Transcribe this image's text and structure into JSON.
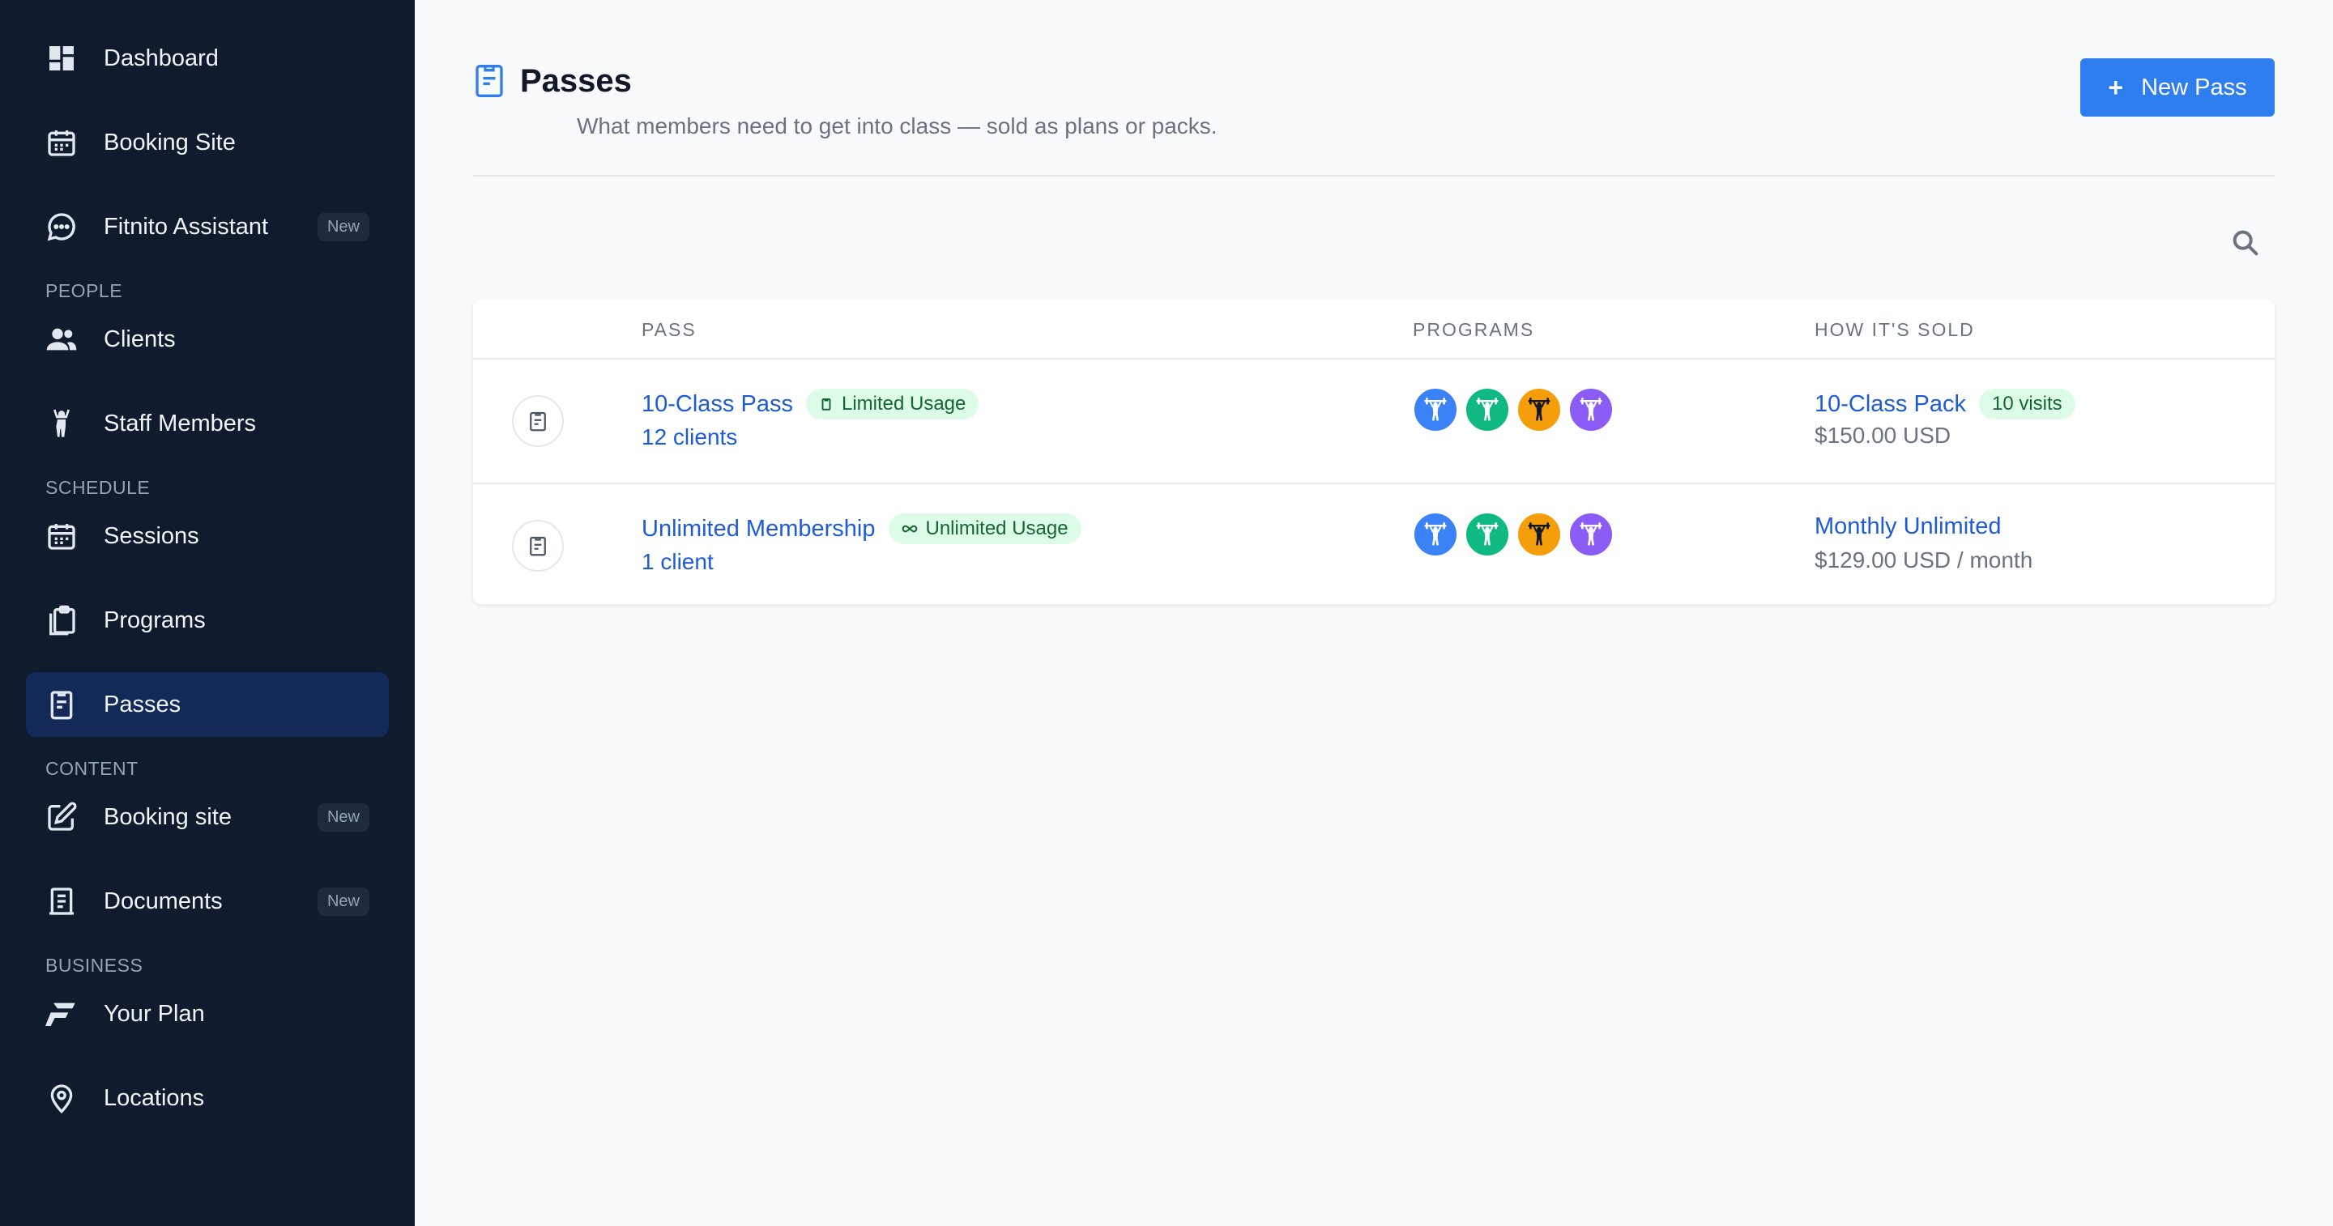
{
  "sidebar": {
    "items_top": [
      {
        "label": "Dashboard",
        "icon": "dashboard-icon"
      },
      {
        "label": "Booking Site",
        "icon": "calendar-icon"
      },
      {
        "label": "Fitnito Assistant",
        "icon": "chat-icon",
        "badge": "New"
      }
    ],
    "sections": [
      {
        "label": "PEOPLE",
        "items": [
          {
            "label": "Clients",
            "icon": "clients-icon"
          },
          {
            "label": "Staff Members",
            "icon": "staff-icon"
          }
        ]
      },
      {
        "label": "SCHEDULE",
        "items": [
          {
            "label": "Sessions",
            "icon": "calendar-icon"
          },
          {
            "label": "Programs",
            "icon": "clipboard-stack-icon"
          },
          {
            "label": "Passes",
            "icon": "pass-icon",
            "active": true
          }
        ]
      },
      {
        "label": "CONTENT",
        "items": [
          {
            "label": "Booking site",
            "icon": "edit-icon",
            "badge": "New"
          },
          {
            "label": "Documents",
            "icon": "document-icon",
            "badge": "New"
          }
        ]
      },
      {
        "label": "BUSINESS",
        "items": [
          {
            "label": "Your Plan",
            "icon": "fitnito-logo-icon"
          },
          {
            "label": "Locations",
            "icon": "location-pin-icon"
          }
        ]
      }
    ]
  },
  "header": {
    "title": "Passes",
    "subtitle": "What members need to get into class — sold as plans or packs.",
    "new_button": "New Pass",
    "new_button_icon": "+"
  },
  "table": {
    "columns": [
      "PASS",
      "PROGRAMS",
      "HOW IT'S SOLD"
    ],
    "rows": [
      {
        "name": "10-Class Pass",
        "usage": "Limited Usage",
        "usage_icon": "clipboard-icon",
        "clients": "12 clients",
        "programs": [
          "#3b82f6",
          "#10b981",
          "#f59e0b",
          "#8b5cf6"
        ],
        "sold_name": "10-Class Pack",
        "sold_badge": "10 visits",
        "price": "$150.00 USD"
      },
      {
        "name": "Unlimited Membership",
        "usage": "Unlimited Usage",
        "usage_icon": "infinity-icon",
        "clients": "1 client",
        "programs": [
          "#3b82f6",
          "#10b981",
          "#f59e0b",
          "#8b5cf6"
        ],
        "sold_name": "Monthly Unlimited",
        "sold_badge": "",
        "price": "$129.00 USD / month"
      }
    ]
  },
  "colors": {
    "sidebar_bg": "#111b2e",
    "active_bg": "#132a59",
    "accent": "#2f7ef0",
    "link": "#1d5bd8",
    "badge_green_bg": "#dcfce7",
    "badge_green_text": "#166534"
  }
}
